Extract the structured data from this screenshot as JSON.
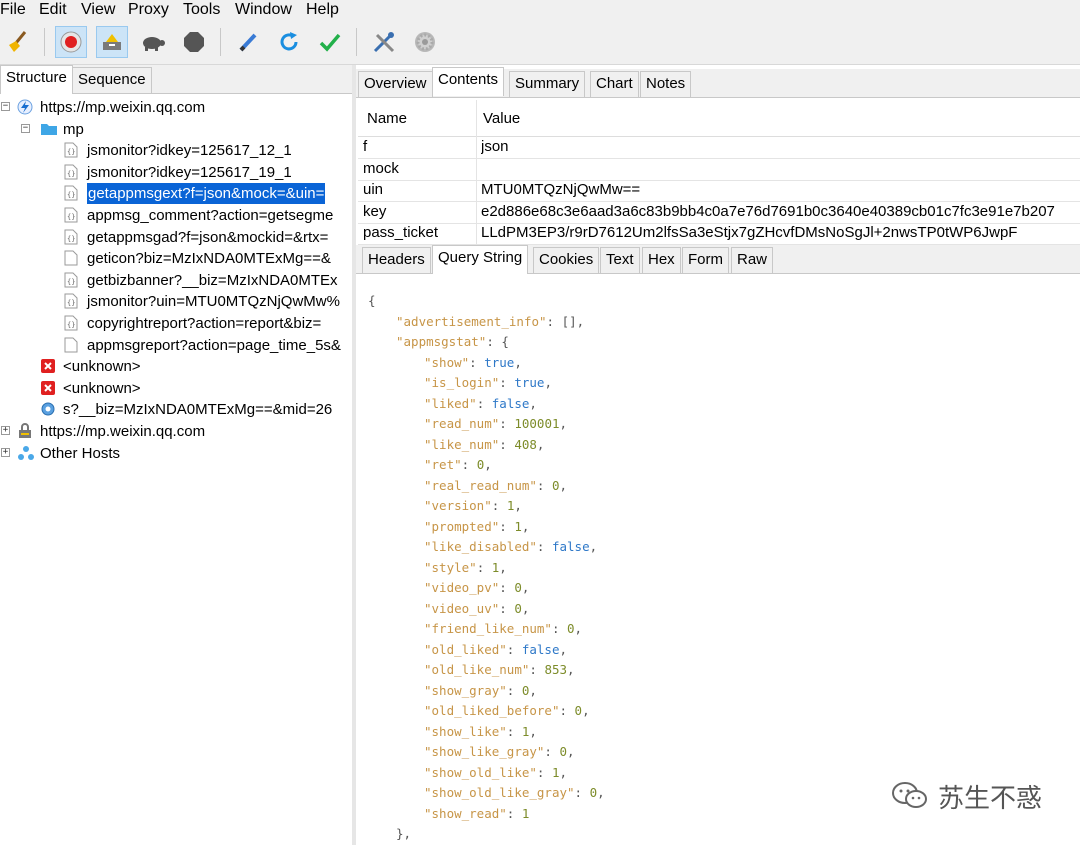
{
  "menu": [
    "File",
    "Edit",
    "View",
    "Proxy",
    "Tools",
    "Window",
    "Help"
  ],
  "left_tabs": [
    "Structure",
    "Sequence"
  ],
  "tree": [
    {
      "label": "https://mp.weixin.qq.com",
      "icon": "lightning-icon",
      "expander": "−"
    },
    {
      "label": "mp",
      "icon": "folder-icon",
      "expander": "−"
    },
    {
      "label": "jsmonitor?idkey=125617_12_1",
      "icon": "json-file-icon"
    },
    {
      "label": "jsmonitor?idkey=125617_19_1",
      "icon": "json-file-icon"
    },
    {
      "label": "getappmsgext?f=json&mock=&uin=",
      "icon": "json-file-icon",
      "selected": true
    },
    {
      "label": "appmsg_comment?action=getsegme",
      "icon": "json-file-icon"
    },
    {
      "label": "getappmsgad?f=json&mockid=&rtx=",
      "icon": "json-file-icon"
    },
    {
      "label": "geticon?biz=MzIxNDA0MTExMg==&",
      "icon": "file-icon"
    },
    {
      "label": "getbizbanner?__biz=MzIxNDA0MTEx",
      "icon": "json-file-icon"
    },
    {
      "label": "jsmonitor?uin=MTU0MTQzNjQwMw%",
      "icon": "json-file-icon"
    },
    {
      "label": "copyrightreport?action=report&biz=",
      "icon": "json-file-icon"
    },
    {
      "label": "appmsgreport?action=page_time_5s&",
      "icon": "file-icon"
    },
    {
      "label": "<unknown>",
      "icon": "error-icon"
    },
    {
      "label": "<unknown>",
      "icon": "error-icon"
    },
    {
      "label": "s?__biz=MzIxNDA0MTExMg==&mid=26",
      "icon": "page-icon"
    },
    {
      "label": "https://mp.weixin.qq.com",
      "icon": "lock-icon",
      "expander": "+"
    },
    {
      "label": "Other Hosts",
      "icon": "hosts-icon",
      "expander": "+"
    }
  ],
  "top_tabs": [
    "Overview",
    "Contents",
    "Summary",
    "Chart",
    "Notes"
  ],
  "table": {
    "headers": [
      "Name",
      "Value"
    ],
    "rows": [
      {
        "name": "f",
        "value": "json"
      },
      {
        "name": "mock",
        "value": ""
      },
      {
        "name": "uin",
        "value": "MTU0MTQzNjQwMw=="
      },
      {
        "name": "key",
        "value": "e2d886e68c3e6aad3a6c83b9bb4c0a7e76d7691b0c3640e40389cb01c7fc3e91e7b207"
      },
      {
        "name": "pass_ticket",
        "value": "LLdPM3EP3/r9rD7612Um2lfsSa3eStjx7gZHcvfDMsNoSgJl+2nwsTP0tWP6JwpF"
      }
    ]
  },
  "bottom_tabs": [
    "Headers",
    "Query String",
    "Cookies",
    "Text",
    "Hex",
    "Form",
    "Raw"
  ],
  "json_lines": [
    {
      "indent": 0,
      "text": "{"
    },
    {
      "indent": 1,
      "key": "advertisement_info",
      "val": "[]",
      "type": "p",
      "comma": true
    },
    {
      "indent": 1,
      "key": "appmsgstat",
      "val": "{",
      "type": "p",
      "comma": false
    },
    {
      "indent": 2,
      "key": "show",
      "val": "true",
      "type": "s",
      "comma": true
    },
    {
      "indent": 2,
      "key": "is_login",
      "val": "true",
      "type": "s",
      "comma": true
    },
    {
      "indent": 2,
      "key": "liked",
      "val": "false",
      "type": "s",
      "comma": true
    },
    {
      "indent": 2,
      "key": "read_num",
      "val": "100001",
      "type": "n",
      "comma": true
    },
    {
      "indent": 2,
      "key": "like_num",
      "val": "408",
      "type": "n",
      "comma": true
    },
    {
      "indent": 2,
      "key": "ret",
      "val": "0",
      "type": "n",
      "comma": true
    },
    {
      "indent": 2,
      "key": "real_read_num",
      "val": "0",
      "type": "n",
      "comma": true
    },
    {
      "indent": 2,
      "key": "version",
      "val": "1",
      "type": "n",
      "comma": true
    },
    {
      "indent": 2,
      "key": "prompted",
      "val": "1",
      "type": "n",
      "comma": true
    },
    {
      "indent": 2,
      "key": "like_disabled",
      "val": "false",
      "type": "s",
      "comma": true
    },
    {
      "indent": 2,
      "key": "style",
      "val": "1",
      "type": "n",
      "comma": true
    },
    {
      "indent": 2,
      "key": "video_pv",
      "val": "0",
      "type": "n",
      "comma": true
    },
    {
      "indent": 2,
      "key": "video_uv",
      "val": "0",
      "type": "n",
      "comma": true
    },
    {
      "indent": 2,
      "key": "friend_like_num",
      "val": "0",
      "type": "n",
      "comma": true
    },
    {
      "indent": 2,
      "key": "old_liked",
      "val": "false",
      "type": "s",
      "comma": true
    },
    {
      "indent": 2,
      "key": "old_like_num",
      "val": "853",
      "type": "n",
      "comma": true
    },
    {
      "indent": 2,
      "key": "show_gray",
      "val": "0",
      "type": "n",
      "comma": true
    },
    {
      "indent": 2,
      "key": "old_liked_before",
      "val": "0",
      "type": "n",
      "comma": true
    },
    {
      "indent": 2,
      "key": "show_like",
      "val": "1",
      "type": "n",
      "comma": true
    },
    {
      "indent": 2,
      "key": "show_like_gray",
      "val": "0",
      "type": "n",
      "comma": true
    },
    {
      "indent": 2,
      "key": "show_old_like",
      "val": "1",
      "type": "n",
      "comma": true
    },
    {
      "indent": 2,
      "key": "show_old_like_gray",
      "val": "0",
      "type": "n",
      "comma": true
    },
    {
      "indent": 2,
      "key": "show_read",
      "val": "1",
      "type": "n",
      "comma": false
    },
    {
      "indent": 1,
      "text": "},"
    }
  ],
  "watermark": "苏生不惑",
  "colors": {
    "selection": "#0a64d6",
    "json_key": "#c79547",
    "json_bool": "#2e78c8",
    "json_number": "#7d8c2a"
  }
}
